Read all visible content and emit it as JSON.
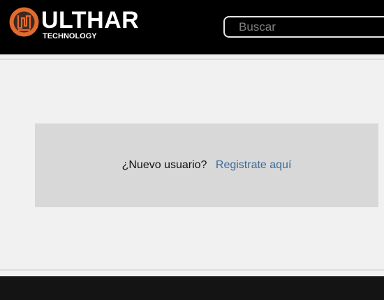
{
  "header": {
    "brand": {
      "name": "ULTHAR",
      "tagline": "TECHNOLOGY",
      "icon": "ulthar-logo-icon",
      "colors": {
        "ring": "#e36a2e",
        "mark": "#3b2a22"
      }
    },
    "search": {
      "placeholder": "Buscar",
      "value": ""
    }
  },
  "main": {
    "register_prompt": "¿Nuevo usuario?",
    "register_link": "Registrate aquí",
    "link_color": "#3a6a99"
  }
}
